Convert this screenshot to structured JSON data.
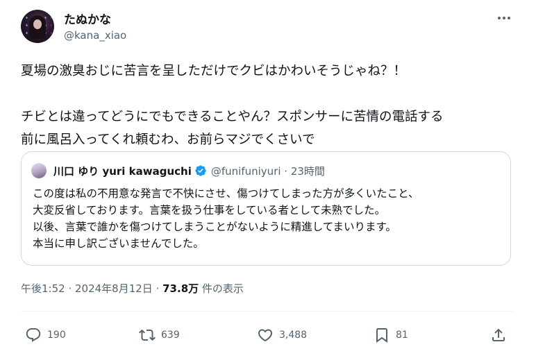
{
  "author": {
    "name": "たぬかな",
    "handle": "@kana_xiao"
  },
  "tweet": {
    "lines": [
      "夏場の激臭おじに苦言を呈しただけでクビはかわいそうじゃね？！",
      "チビとは違ってどうにでもできることやん？スポンサーに苦情の電話する",
      "前に風呂入ってくれ頼むわ、お前らマジでくさいで"
    ]
  },
  "quote": {
    "name": "川口 ゆり yuri kawaguchi",
    "handle_time": "@funifuniyuri · 23時間",
    "lines": [
      "この度は私の不用意な発言で不快にさせ、傷つけてしまった方が多くいたこと、",
      "大変反省しております。言葉を扱う仕事をしている者として未熟でした。",
      "以後、言葉で誰かを傷つけてしまうことがないように精進してまいります。",
      "本当に申し訳ございませんでした。"
    ]
  },
  "meta": {
    "timestamp": "午後1:52 · 2024年8月12日 ·",
    "views": "73.8万",
    "views_label": "件の表示"
  },
  "actions": {
    "replies": "190",
    "retweets": "639",
    "likes": "3,488",
    "bookmarks": "81"
  },
  "colors": {
    "text": "#0f1419",
    "secondary": "#536471",
    "border": "#cfd9de",
    "verified": "#1d9bf0"
  },
  "icons": [
    "more-icon",
    "verified-icon",
    "reply-icon",
    "retweet-icon",
    "like-icon",
    "bookmark-icon",
    "share-icon"
  ]
}
